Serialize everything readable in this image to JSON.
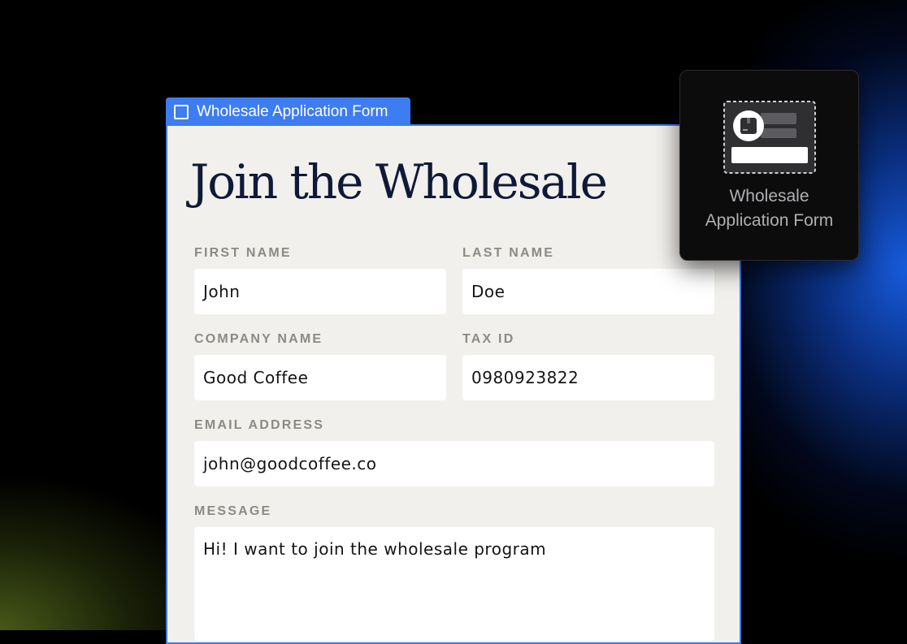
{
  "selection": {
    "tag_label": "Wholesale Application Form"
  },
  "form": {
    "title": "Join the Wholesale",
    "fields": {
      "first_name": {
        "label": "FIRST NAME",
        "value": "John"
      },
      "last_name": {
        "label": "LAST NAME",
        "value": "Doe"
      },
      "company_name": {
        "label": "COMPANY NAME",
        "value": "Good Coffee"
      },
      "tax_id": {
        "label": "TAX ID",
        "value": "0980923822"
      },
      "email": {
        "label": "EMAIL ADDRESS",
        "value": "john@goodcoffee.co"
      },
      "message": {
        "label": "MESSAGE",
        "value": "Hi! I want to join the wholesale program"
      }
    }
  },
  "widget": {
    "label": "Wholesale\nApplication Form",
    "icon": "form-block-icon"
  },
  "colors": {
    "accent": "#3d7cf1",
    "card_background": "#f2f0ed",
    "title": "#0f1a38",
    "label": "#8d8a85",
    "widget_background": "#0c0c0d"
  }
}
